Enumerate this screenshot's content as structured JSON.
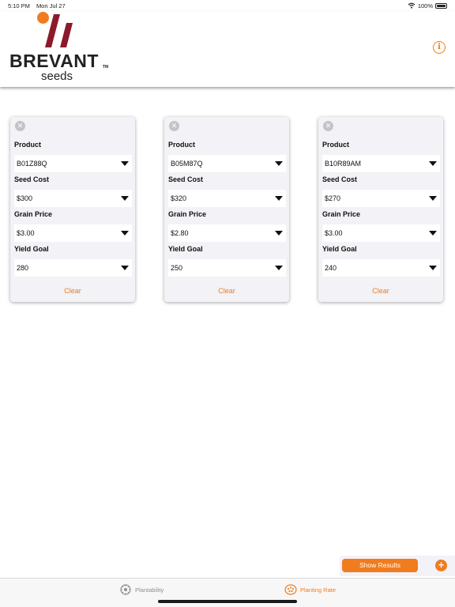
{
  "status_bar": {
    "time": "5:10 PM",
    "date": "Mon Jul 27",
    "battery": "100%"
  },
  "brand": {
    "name": "BREVANT",
    "sub": "seeds",
    "tm": "TM",
    "accent": "#f07c1e",
    "bar_color": "#8b1a2b"
  },
  "header": {
    "info_icon": "info-icon"
  },
  "cards": [
    {
      "product_label": "Product",
      "product": "B01Z88Q",
      "seed_cost_label": "Seed Cost",
      "seed_cost": "$300",
      "grain_price_label": "Grain Price",
      "grain_price": "$3.00",
      "yield_goal_label": "Yield Goal",
      "yield_goal": "280",
      "clear_label": "Clear"
    },
    {
      "product_label": "Product",
      "product": "B05M87Q",
      "seed_cost_label": "Seed Cost",
      "seed_cost": "$320",
      "grain_price_label": "Grain Price",
      "grain_price": "$2.80",
      "yield_goal_label": "Yield Goal",
      "yield_goal": "250",
      "clear_label": "Clear"
    },
    {
      "product_label": "Product",
      "product": "B10R89AM",
      "seed_cost_label": "Seed Cost",
      "seed_cost": "$270",
      "grain_price_label": "Grain Price",
      "grain_price": "$3.00",
      "yield_goal_label": "Yield Goal",
      "yield_goal": "240",
      "clear_label": "Clear"
    }
  ],
  "actions": {
    "show_results": "Show Results",
    "add": "+"
  },
  "tabs": [
    {
      "label": "Plantability",
      "icon": "plantability-icon",
      "active": false
    },
    {
      "label": "Planting Rate",
      "icon": "planting-rate-icon",
      "active": true
    }
  ]
}
